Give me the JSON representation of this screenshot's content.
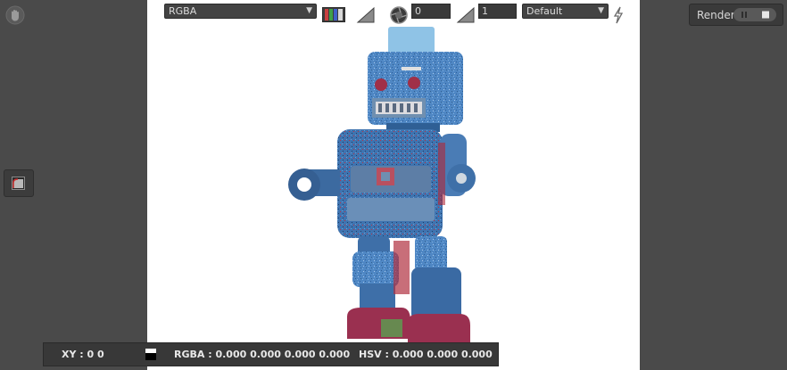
{
  "toolbar": {
    "channel_select": "RGBA",
    "exposure_value": "0",
    "gamma_value": "1",
    "lut_select": "Default"
  },
  "render_panel": {
    "label": "Render"
  },
  "info_bar": {
    "xy": "XY : 0 0",
    "rgba": "RGBA : 0.000 0.000 0.000 0.000",
    "hsv": "HSV : 0.000 0.000 0.000"
  },
  "icons": [
    "hand-icon",
    "display-mode-icon",
    "color-channels-icon",
    "exposure-ramp-icon",
    "aperture-icon",
    "gamma-ramp-icon",
    "lightning-icon",
    "pause-icon",
    "stop-icon"
  ]
}
